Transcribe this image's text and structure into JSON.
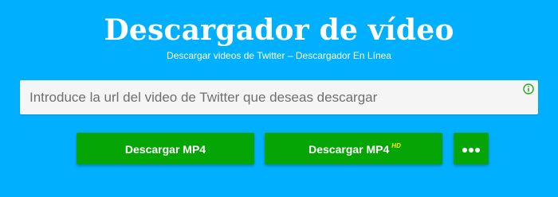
{
  "header": {
    "title": "Descargador de vídeo",
    "subtitle": "Descargar videos de Twitter – Descargador En Línea"
  },
  "url_input": {
    "placeholder": "Introduce la url del video de Twitter que deseas descargar",
    "value": "",
    "info_icon": "info-icon"
  },
  "buttons": {
    "mp4_label": "Descargar MP4",
    "mp4_hd_label": "Descargar MP4",
    "hd_badge": "HD",
    "more_icon": "more-dots-icon"
  },
  "colors": {
    "background": "#00b0ff",
    "button": "#05a505",
    "hd_badge": "#ffee00",
    "info_icon": "#22aa22"
  }
}
